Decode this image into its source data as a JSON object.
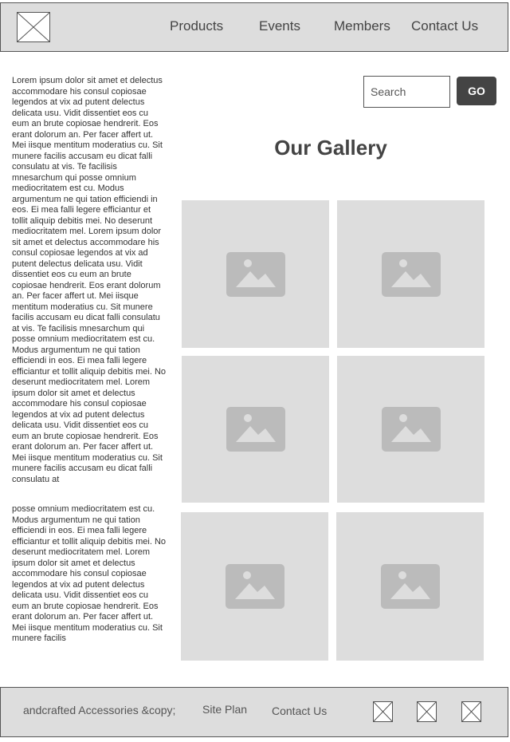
{
  "header": {
    "logo_icon": "placeholder-image-icon",
    "nav": [
      "Products",
      "Events",
      "Members",
      "Contact Us"
    ]
  },
  "sidebar": {
    "paragraph_top": "Lorem ipsum dolor sit amet et delectus accommodare his consul copiosae legendos at vix ad putent delectus delicata usu. Vidit dissentiet eos cu eum an brute copiosae hendrerit. Eos erant dolorum an. Per facer affert ut. Mei iisque mentitum moderatius cu. Sit munere facilis accusam eu dicat falli consulatu at vis. Te facilisis mnesarchum qui posse omnium mediocritatem est cu. Modus argumentum ne qui tation efficiendi in eos. Ei mea falli legere efficiantur et tollit aliquip debitis mei. No deserunt mediocritatem mel. Lorem ipsum dolor sit amet et delectus accommodare his consul copiosae legendos at vix ad putent delectus delicata usu. Vidit dissentiet eos cu eum an brute copiosae hendrerit. Eos erant dolorum an. Per facer affert ut. Mei iisque mentitum moderatius cu. Sit munere facilis accusam eu dicat falli consulatu at vis. Te facilisis mnesarchum qui posse omnium mediocritatem est cu. Modus argumentum ne qui tation efficiendi in eos. Ei mea falli legere efficiantur et tollit aliquip debitis mei. No deserunt mediocritatem mel. Lorem ipsum dolor sit amet et delectus accommodare his consul copiosae legendos at vix ad putent delectus delicata usu. Vidit dissentiet eos cu eum an brute copiosae hendrerit. Eos erant dolorum an. Per facer affert ut. Mei iisque mentitum moderatius cu. Sit munere facilis accusam eu dicat falli consulatu at",
    "paragraph_bottom": "posse omnium mediocritatem est cu. Modus argumentum ne qui tation efficiendi in eos. Ei mea falli legere efficiantur et tollit aliquip debitis mei. No deserunt mediocritatem mel. Lorem ipsum dolor sit amet et delectus accommodare his consul copiosae legendos at vix ad putent delectus delicata usu. Vidit dissentiet eos cu eum an brute copiosae hendrerit. Eos erant dolorum an. Per facer affert ut. Mei iisque mentitum moderatius cu. Sit munere facilis"
  },
  "search": {
    "placeholder": "Search",
    "value": "",
    "button_label": "GO"
  },
  "gallery": {
    "title": "Our Gallery",
    "tile_icon": "placeholder-image-icon",
    "tile_count": 6
  },
  "footer": {
    "copyright": "andcrafted Accessories &copy;",
    "links": [
      "Site Plan",
      "Contact Us"
    ],
    "social_icons": [
      "placeholder-image-icon",
      "placeholder-image-icon",
      "placeholder-image-icon"
    ]
  },
  "colors": {
    "panel_bg": "#dddddd",
    "button_bg": "#444444",
    "icon_fill": "#bbbbbb"
  }
}
